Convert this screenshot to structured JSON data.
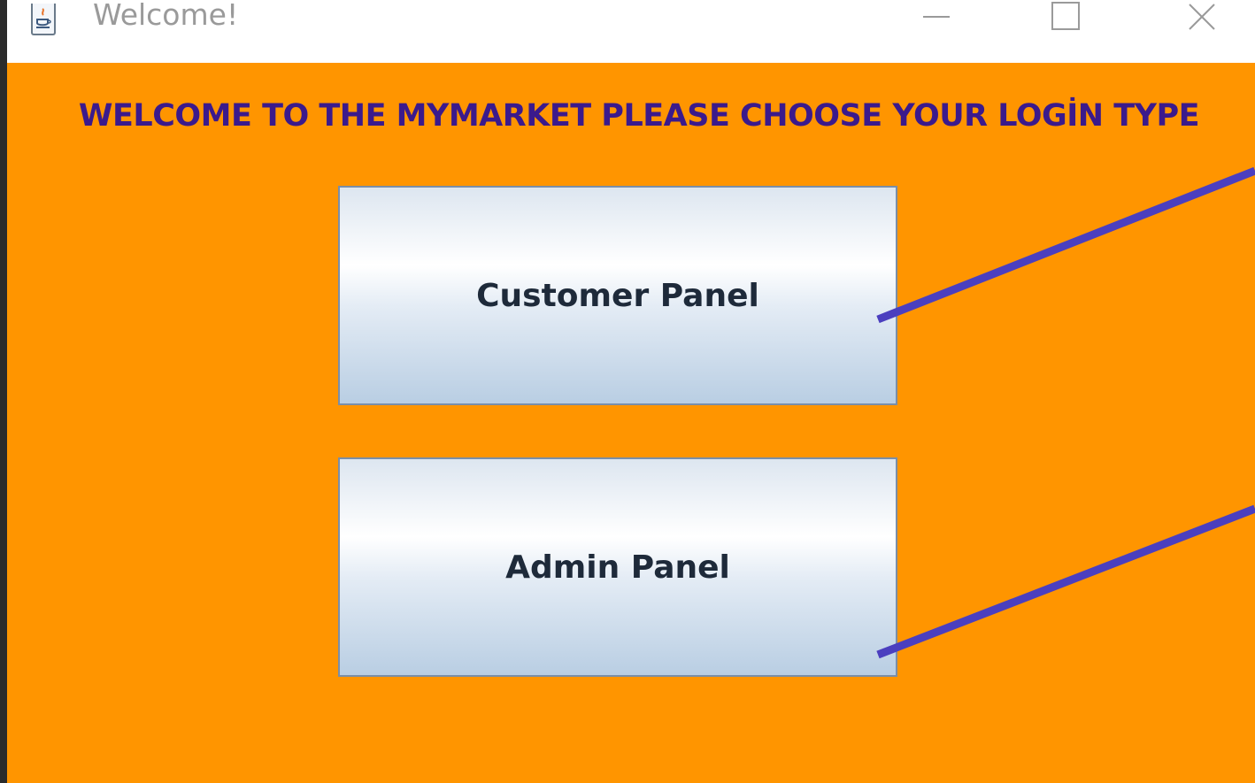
{
  "window": {
    "title": "Welcome!",
    "app_icon": "java-cup-icon"
  },
  "controls": {
    "minimize_icon": "minimize-icon",
    "maximize_icon": "maximize-icon",
    "close_icon": "close-icon"
  },
  "main": {
    "heading": "WELCOME TO THE MYMARKET PLEASE CHOOSE YOUR LOGİN TYPE",
    "customer_button_label": "Customer Panel",
    "admin_button_label": "Admin Panel"
  },
  "colors": {
    "background": "#ff9500",
    "heading": "#3b1a8c",
    "annotation_line": "#4b3fbf"
  }
}
